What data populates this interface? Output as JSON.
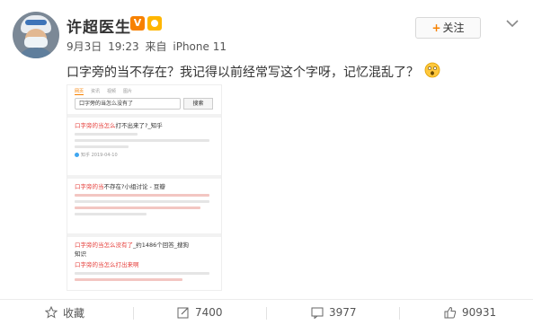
{
  "author": {
    "name": "许超医生",
    "verified_badge": "V"
  },
  "meta": {
    "date": "9月3日",
    "time": "19:23",
    "from_label": "来自",
    "device": "iPhone 11"
  },
  "follow_label": "关注",
  "post_text": "口字旁的当不存在？我记得以前经常写这个字呀，记忆混乱了？",
  "image": {
    "tabs": [
      "网页",
      "资讯",
      "视频",
      "图片"
    ],
    "search_value": "口字旁的当怎么没有了",
    "search_button": "搜索",
    "results": [
      {
        "title_hl": "口字旁的当怎么",
        "title_rest": "打不出来了?_知乎",
        "source": "知乎  2019-04-10"
      },
      {
        "title_hl": "口字旁的当",
        "title_rest": "不存在?小组讨论 - 豆瓣",
        "source": ""
      },
      {
        "title_hl": "口字旁的当怎么没有了",
        "title_rest": "_约1486个回答_搜狗",
        "sub": "知识",
        "sub2": "口字旁的当怎么打出来啊",
        "source": ""
      }
    ]
  },
  "actions": {
    "favorite": "收藏",
    "repost": "7400",
    "comment": "3977",
    "like": "90931"
  },
  "colors": {
    "accent": "#f78100",
    "highlight": "#e6403c"
  }
}
